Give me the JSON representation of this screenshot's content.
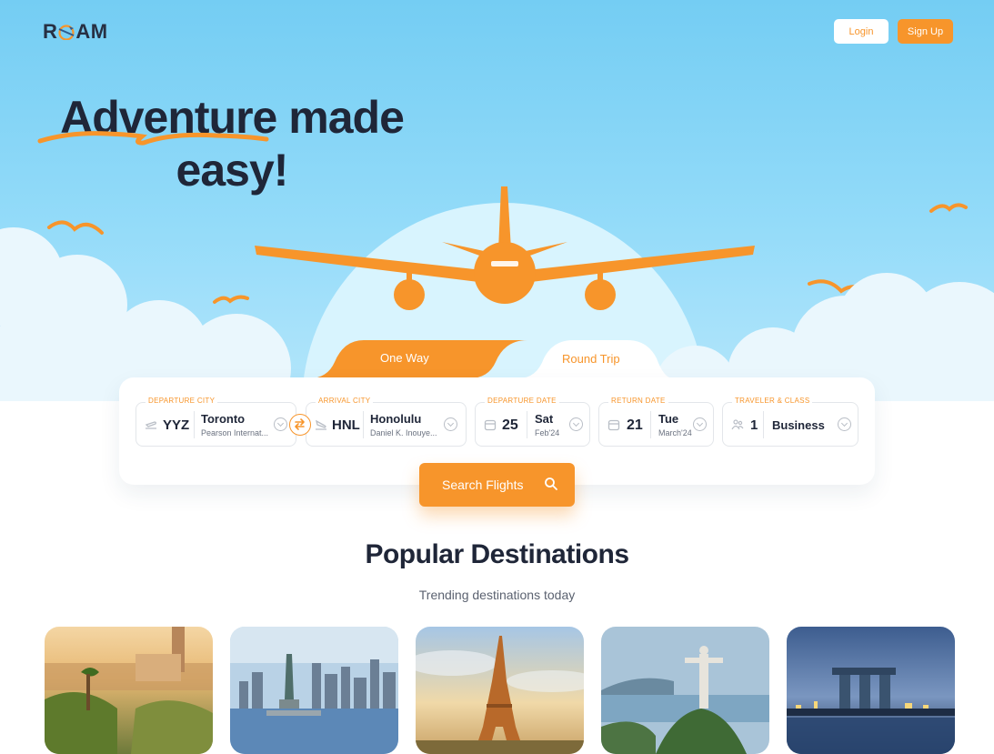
{
  "brand": {
    "logo_left": "R",
    "logo_right": "AM"
  },
  "nav": {
    "login_label": "Login",
    "signup_label": "Sign Up"
  },
  "hero": {
    "headline_line1_a": "Adventure",
    "headline_line1_b": "made",
    "headline_line2": "easy!"
  },
  "trip_tabs": [
    {
      "label": "One Way",
      "active": false
    },
    {
      "label": "Round Trip",
      "active": true
    }
  ],
  "search": {
    "departure": {
      "legend": "DEPARTURE CITY",
      "code": "YYZ",
      "city": "Toronto",
      "airport": "Pearson Internat..."
    },
    "arrival": {
      "legend": "ARRIVAL CITY",
      "code": "HNL",
      "city": "Honolulu",
      "airport": "Daniel K. Inouye..."
    },
    "departure_date": {
      "legend": "DEPARTURE DATE",
      "day": "25",
      "weekday": "Sat",
      "month": "Feb'24"
    },
    "return_date": {
      "legend": "RETURN DATE",
      "day": "21",
      "weekday": "Tue",
      "month": "March'24"
    },
    "traveler": {
      "legend": "TRAVELER & CLASS",
      "count": "1",
      "class": "Business"
    },
    "button_label": "Search Flights"
  },
  "popular": {
    "title": "Popular Destinations",
    "subtitle": "Trending destinations today"
  },
  "destinations": [
    {
      "icon": "barcelona-park-guell-image"
    },
    {
      "icon": "new-york-statue-of-liberty-image"
    },
    {
      "icon": "paris-eiffel-tower-image"
    },
    {
      "icon": "rio-christ-redeemer-image"
    },
    {
      "icon": "singapore-marina-bay-image"
    }
  ],
  "colors": {
    "accent": "#f7952b",
    "sky": "#7fd3f6",
    "text_dark": "#1f2638"
  }
}
